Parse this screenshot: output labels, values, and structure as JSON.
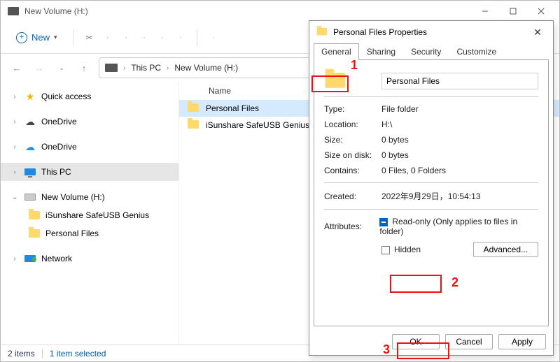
{
  "window": {
    "title": "New Volume (H:)"
  },
  "toolbar": {
    "new_label": "New"
  },
  "breadcrumb": {
    "root": "This PC",
    "segment": "New Volume (H:)"
  },
  "sidebar": {
    "quick_access": "Quick access",
    "onedrive_local": "OneDrive",
    "onedrive_cloud": "OneDrive",
    "this_pc": "This PC",
    "volume": "New Volume (H:)",
    "child_a": "iSunshare SafeUSB Genius",
    "child_b": "Personal Files",
    "network": "Network"
  },
  "list": {
    "name_header": "Name",
    "items": [
      {
        "name": "Personal Files",
        "selected": true
      },
      {
        "name": "iSunshare SafeUSB Genius",
        "selected": false
      }
    ]
  },
  "statusbar": {
    "items": "2 items",
    "selected": "1 item selected"
  },
  "props": {
    "title": "Personal Files Properties",
    "tabs": {
      "general": "General",
      "sharing": "Sharing",
      "security": "Security",
      "customize": "Customize"
    },
    "name_value": "Personal Files",
    "labels": {
      "type": "Type:",
      "location": "Location:",
      "size": "Size:",
      "size_on_disk": "Size on disk:",
      "contains": "Contains:",
      "created": "Created:",
      "attributes": "Attributes:"
    },
    "values": {
      "type": "File folder",
      "location": "H:\\",
      "size": "0 bytes",
      "size_on_disk": "0 bytes",
      "contains": "0 Files, 0 Folders",
      "created": "2022年9月29日，10:54:13"
    },
    "readonly_label": "Read-only (Only applies to files in folder)",
    "hidden_label": "Hidden",
    "advanced_label": "Advanced...",
    "buttons": {
      "ok": "OK",
      "cancel": "Cancel",
      "apply": "Apply"
    }
  },
  "annotations": {
    "one": "1",
    "two": "2",
    "three": "3"
  }
}
